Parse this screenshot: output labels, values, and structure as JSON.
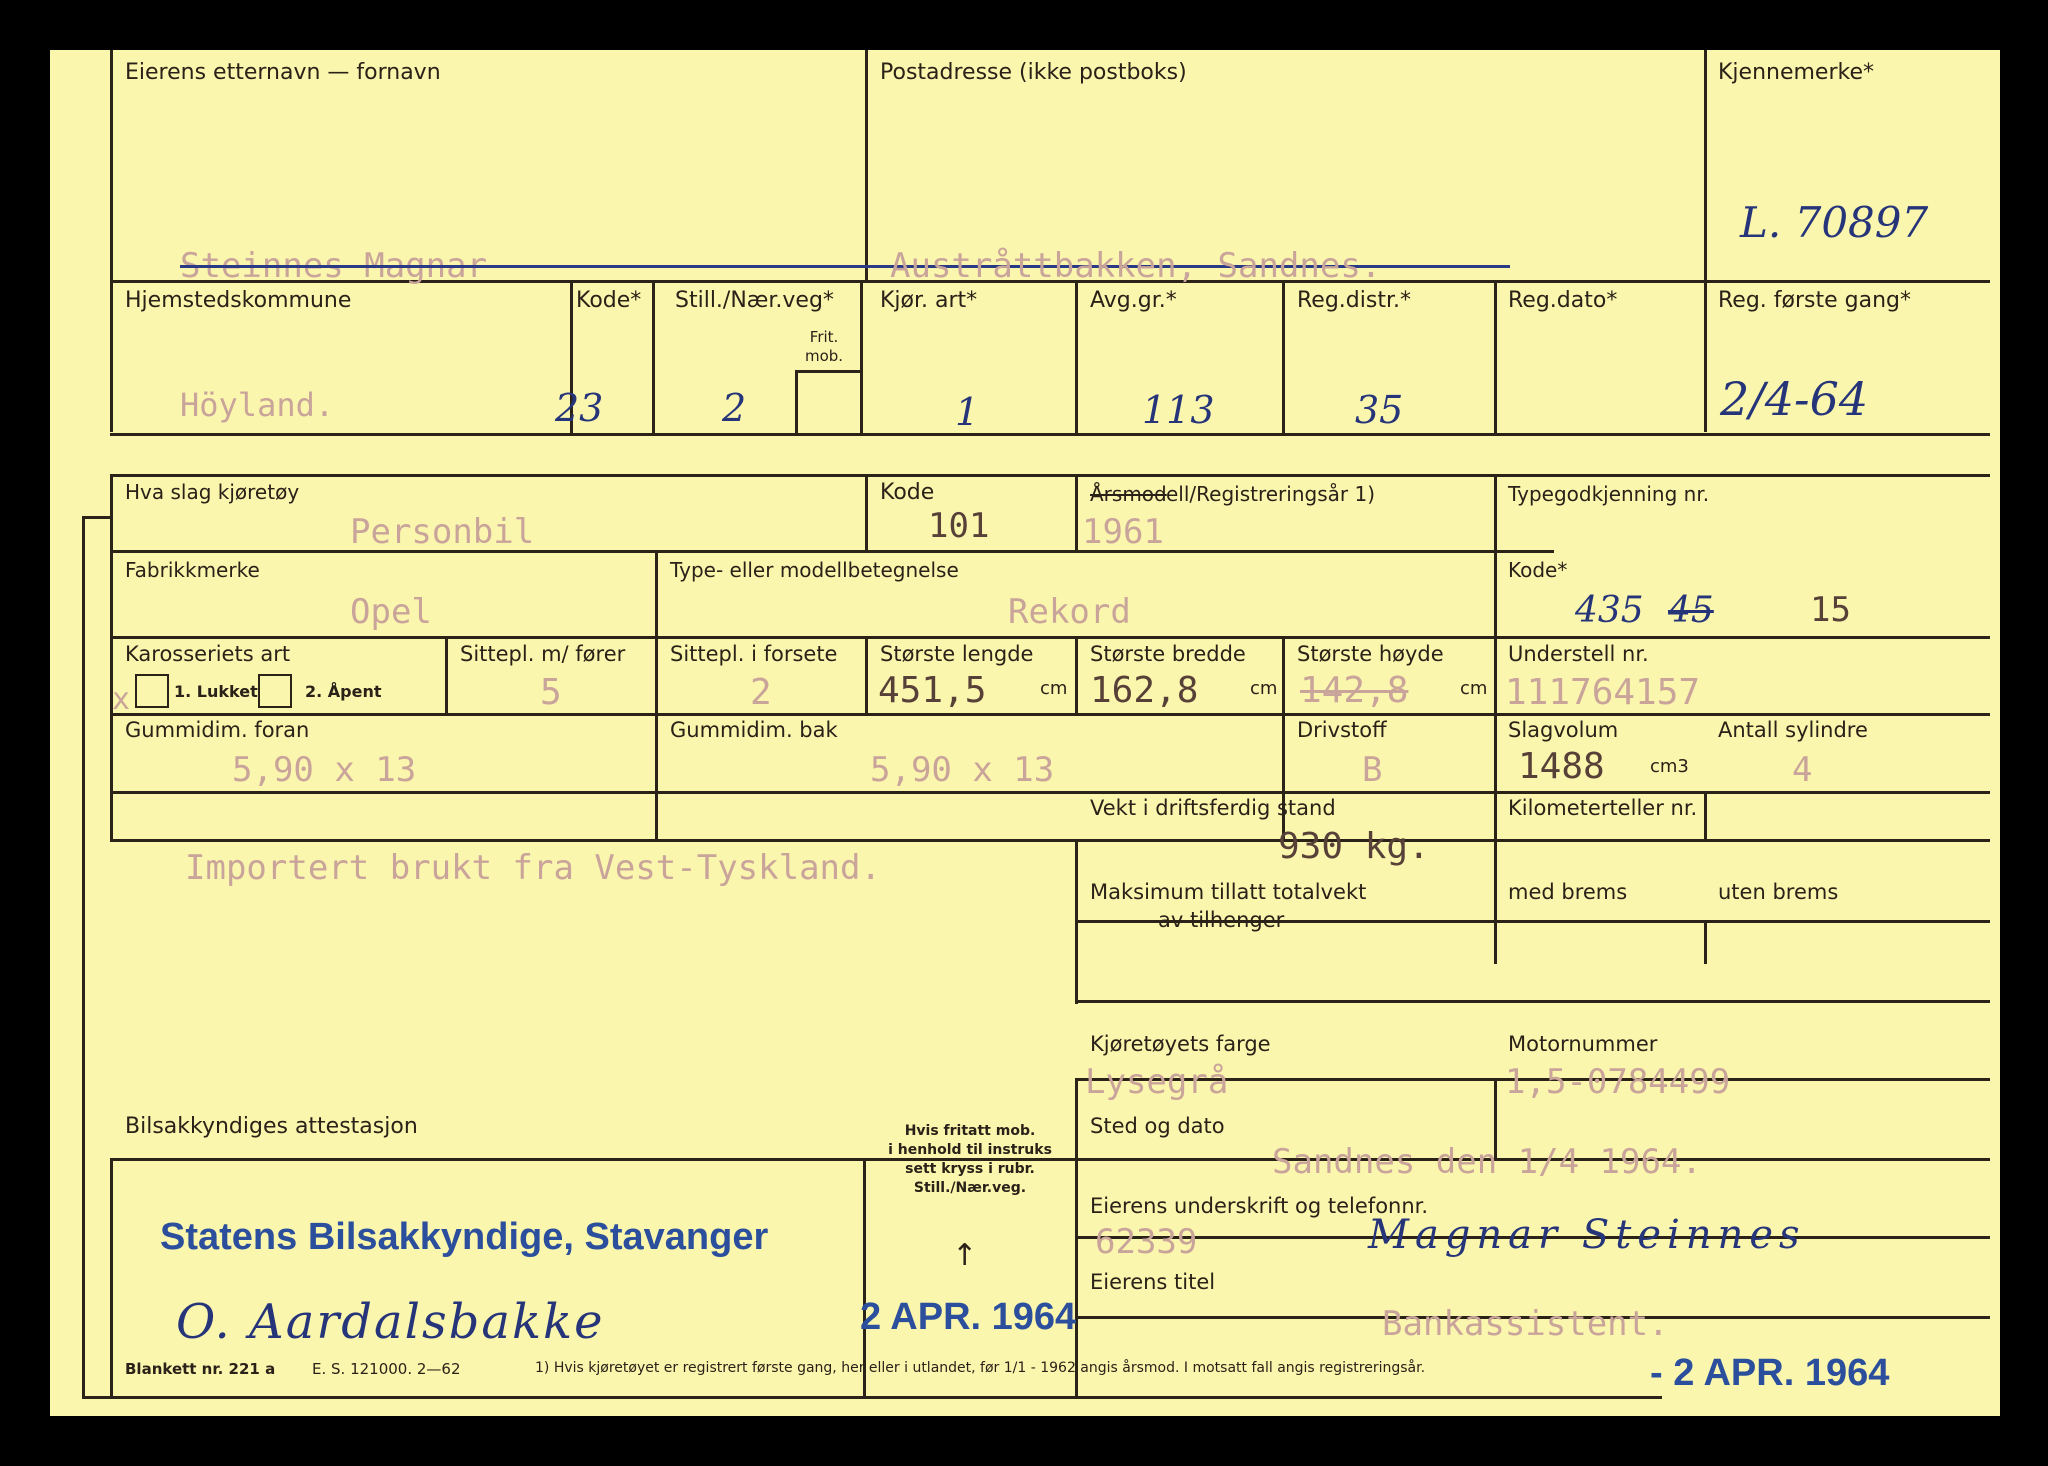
{
  "labels": {
    "owner_name": "Eierens etternavn — fornavn",
    "postal_address": "Postadresse (ikke postboks)",
    "plate": "Kjennemerke*",
    "municipality": "Hjemstedskommune",
    "code": "Kode*",
    "still_naer_veg": "Still./Nær.veg*",
    "frit_mob": "Frit.\nmob.",
    "kjor_art": "Kjør. art*",
    "avg_gr": "Avg.gr.*",
    "reg_distr": "Reg.distr.*",
    "reg_dato": "Reg.dato*",
    "reg_first": "Reg. første gang*",
    "vehicle_kind": "Hva slag kjøretøy",
    "kode": "Kode",
    "arsmod_struck": "Årsmod",
    "model_year": "ell/Registreringsår 1)",
    "type_approval": "Typegodkjenning nr.",
    "make": "Fabrikkmerke",
    "model": "Type- eller modellbetegnelse",
    "kode2": "Kode*",
    "body_type": "Karosseriets art",
    "seats_driver": "Sittepl. m/ fører",
    "seats_front": "Sittepl. i forsete",
    "max_length": "Største lengde",
    "max_width": "Største bredde",
    "max_height": "Største høyde",
    "chassis": "Understell nr.",
    "closed": "1. Lukket",
    "open": "2. Åpent",
    "tyre_front": "Gummidim. foran",
    "tyre_rear": "Gummidim. bak",
    "fuel": "Drivstoff",
    "displacement": "Slagvolum",
    "cylinders": "Antall sylindre",
    "weight": "Vekt i driftsferdig stand",
    "odometer": "Kilometerteller nr.",
    "max_trailer": "Maksimum tillatt totalvekt",
    "max_trailer2": "av tilhenger",
    "with_brakes": "med brems",
    "without_brakes": "uten brems",
    "color": "Kjøretøyets farge",
    "engine_no": "Motornummer",
    "attestation": "Bilsakkyndiges attestasjon",
    "fritatt_note": "Hvis fritatt mob.\ni henhold til instruks\nsett kryss i rubr.\nStill./Nær.veg.",
    "place_date": "Sted og dato",
    "signature": "Eierens underskrift og telefonnr.",
    "title": "Eierens titel",
    "unit_cm": "cm",
    "unit_cm3": "cm3"
  },
  "values": {
    "owner": "Steinnes Magnar",
    "address": "Austråttbakken, Sandnes.",
    "plate": "L. 70897",
    "municipality": "Höyland.",
    "code": "23",
    "still": "2",
    "kjor_art": "1",
    "avg_gr": "113",
    "reg_distr": "35",
    "reg_first": "2/4-64",
    "vehicle_kind": "Personbil",
    "kode": "101",
    "year": "1961",
    "make": "Opel",
    "model": "Rekord",
    "kode2_old": "435",
    "kode2_struck": "45",
    "kode2_new": "15",
    "body_mark": "x",
    "seats_driver": "5",
    "seats_front": "2",
    "length": "451,5",
    "width": "162,8",
    "height": "142,8",
    "chassis": "111764157",
    "tyre_front": "5,90 x 13",
    "tyre_rear": "5,90 x 13",
    "fuel": "B",
    "displacement": "1488",
    "cylinders": "4",
    "weight": "930 kg.",
    "note": "Importert brukt fra Vest-Tyskland.",
    "color": "Lysegrå",
    "engine": "1,5-0784499",
    "place_date": "Sandnes den 1/4 1964.",
    "phone": "62339",
    "owner_signature": "Magnar Steinnes",
    "owner_title": "Bankassistent.",
    "stamp_office": "Statens Bilsakkyndige, Stavanger",
    "inspector_signature": "O. Aardalsbakke",
    "stamp_date1": "2 APR. 1964",
    "stamp_date2": "- 2 APR. 1964"
  },
  "footer": {
    "form_no": "Blankett nr. 221 a",
    "es": "E. S. 121000. 2—62",
    "footnote": "1) Hvis kjøretøyet er registrert første gang, her eller i utlandet, før 1/1 - 1962 angis årsmod. I motsatt fall angis registreringsår."
  }
}
